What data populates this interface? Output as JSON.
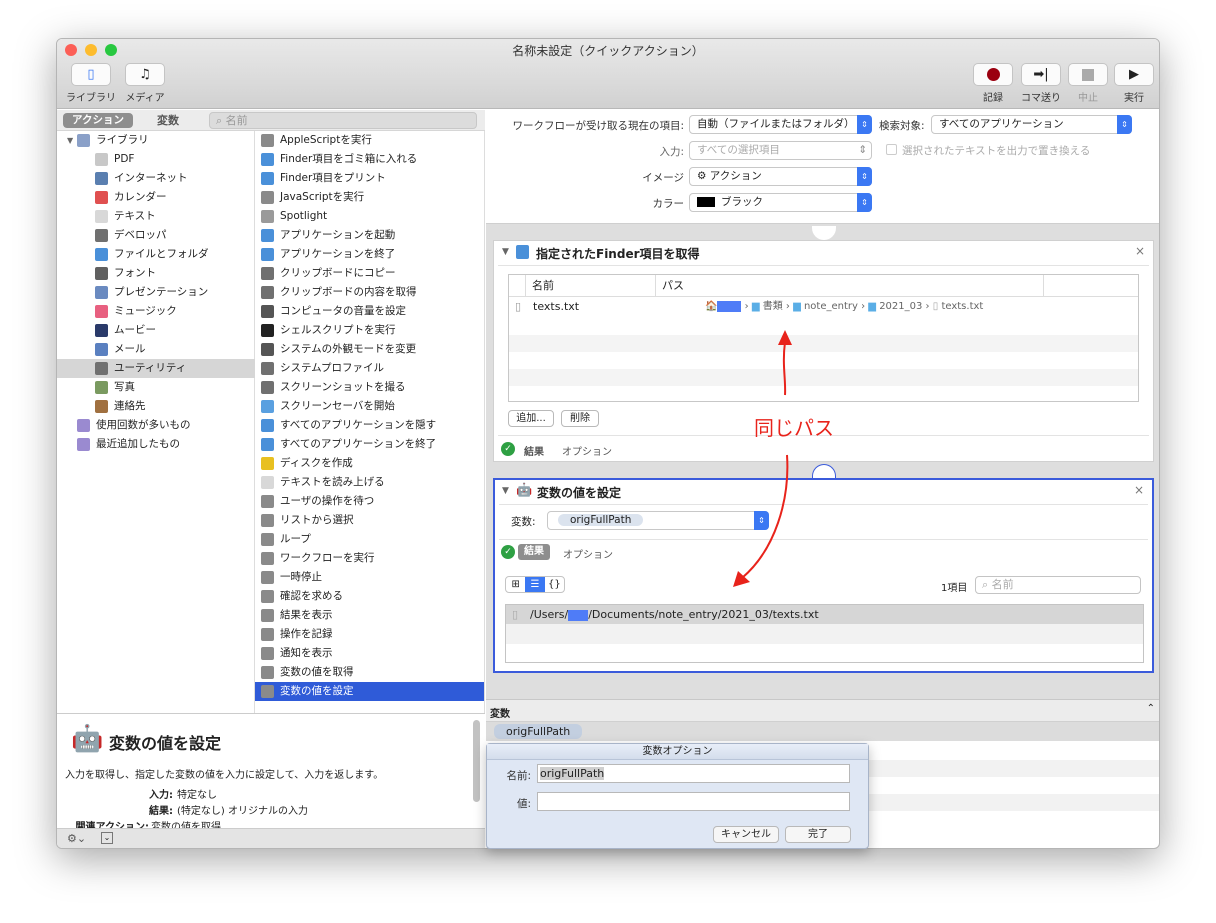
{
  "window": {
    "title": "名称未設定（クイックアクション）"
  },
  "toolbar": {
    "library": "ライブラリ",
    "media": "メディア",
    "record": "記録",
    "step": "コマ送り",
    "stop": "中止",
    "run": "実行"
  },
  "left_tabs": {
    "actions": "アクション",
    "variables": "変数",
    "search_placeholder": "名前"
  },
  "library": [
    {
      "label": "ライブラリ",
      "icon": "library-icon",
      "color": "#8aa0c8"
    },
    {
      "label": "PDF",
      "icon": "pdf-icon",
      "color": "#c8c8c8"
    },
    {
      "label": "インターネット",
      "icon": "globe-icon",
      "color": "#5a7fb0"
    },
    {
      "label": "カレンダー",
      "icon": "calendar-icon",
      "color": "#e05050"
    },
    {
      "label": "テキスト",
      "icon": "text-icon",
      "color": "#d8d8d8"
    },
    {
      "label": "デベロッパ",
      "icon": "tools-icon",
      "color": "#707070"
    },
    {
      "label": "ファイルとフォルダ",
      "icon": "finder-icon",
      "color": "#4a90d9"
    },
    {
      "label": "フォント",
      "icon": "font-icon",
      "color": "#606060"
    },
    {
      "label": "プレゼンテーション",
      "icon": "presentation-icon",
      "color": "#6a8ac0"
    },
    {
      "label": "ミュージック",
      "icon": "music-icon",
      "color": "#e86080"
    },
    {
      "label": "ムービー",
      "icon": "movie-icon",
      "color": "#2a3a6a"
    },
    {
      "label": "メール",
      "icon": "mail-icon",
      "color": "#5a80c0"
    },
    {
      "label": "ユーティリティ",
      "icon": "utility-icon",
      "color": "#707070",
      "selected": true
    },
    {
      "label": "写真",
      "icon": "photo-icon",
      "color": "#7a9a60"
    },
    {
      "label": "連絡先",
      "icon": "contacts-icon",
      "color": "#a07040"
    },
    {
      "label": "使用回数が多いもの",
      "icon": "smart-folder-icon",
      "color": "#9a8ad0"
    },
    {
      "label": "最近追加したもの",
      "icon": "smart-folder-icon",
      "color": "#9a8ad0"
    }
  ],
  "actions": [
    {
      "label": "AppleScriptを実行",
      "icon": "automator-icon"
    },
    {
      "label": "Finder項目をゴミ箱に入れる",
      "icon": "finder-icon"
    },
    {
      "label": "Finder項目をプリント",
      "icon": "finder-icon"
    },
    {
      "label": "JavaScriptを実行",
      "icon": "automator-icon"
    },
    {
      "label": "Spotlight",
      "icon": "spotlight-icon"
    },
    {
      "label": "アプリケーションを起動",
      "icon": "finder-icon"
    },
    {
      "label": "アプリケーションを終了",
      "icon": "finder-icon"
    },
    {
      "label": "クリップボードにコピー",
      "icon": "tools-icon"
    },
    {
      "label": "クリップボードの内容を取得",
      "icon": "tools-icon"
    },
    {
      "label": "コンピュータの音量を設定",
      "icon": "settings-icon"
    },
    {
      "label": "シェルスクリプトを実行",
      "icon": "terminal-icon"
    },
    {
      "label": "システムの外観モードを変更",
      "icon": "settings-icon"
    },
    {
      "label": "システムプロファイル",
      "icon": "tools-icon"
    },
    {
      "label": "スクリーンショットを撮る",
      "icon": "tools-icon"
    },
    {
      "label": "スクリーンセーバを開始",
      "icon": "screensaver-icon"
    },
    {
      "label": "すべてのアプリケーションを隠す",
      "icon": "finder-icon"
    },
    {
      "label": "すべてのアプリケーションを終了",
      "icon": "finder-icon"
    },
    {
      "label": "ディスクを作成",
      "icon": "radiation-icon"
    },
    {
      "label": "テキストを読み上げる",
      "icon": "text-icon"
    },
    {
      "label": "ユーザの操作を待つ",
      "icon": "automator-icon"
    },
    {
      "label": "リストから選択",
      "icon": "automator-icon"
    },
    {
      "label": "ループ",
      "icon": "automator-icon"
    },
    {
      "label": "ワークフローを実行",
      "icon": "automator-icon"
    },
    {
      "label": "一時停止",
      "icon": "automator-icon"
    },
    {
      "label": "確認を求める",
      "icon": "automator-icon"
    },
    {
      "label": "結果を表示",
      "icon": "automator-icon"
    },
    {
      "label": "操作を記録",
      "icon": "automator-icon"
    },
    {
      "label": "通知を表示",
      "icon": "automator-icon"
    },
    {
      "label": "変数の値を取得",
      "icon": "automator-icon"
    },
    {
      "label": "変数の値を設定",
      "icon": "automator-icon",
      "selected": true
    }
  ],
  "description": {
    "title": "変数の値を設定",
    "text": "入力を取得し、指定した変数の値を入力に設定して、入力を返します。",
    "input_label": "入力:",
    "input_value": "特定なし",
    "result_label": "結果:",
    "result_value": "(特定なし) オリジナルの入力",
    "related_label": "関連アクション:",
    "related_value": "変数の値を取得"
  },
  "workflow_settings": {
    "receives_label": "ワークフローが受け取る現在の項目:",
    "receives_value": "自動（ファイルまたはフォルダ）",
    "search_label": "検索対象:",
    "search_value": "すべてのアプリケーション",
    "input_label": "入力:",
    "input_value": "すべての選択項目",
    "replace_label": "選択されたテキストを出力で置き換える",
    "image_label": "イメージ",
    "image_value": "アクション",
    "color_label": "カラー",
    "color_value": "ブラック",
    "color_swatch": "#000000"
  },
  "action1": {
    "title": "指定されたFinder項目を取得",
    "col_name": "名前",
    "col_path": "パス",
    "row": {
      "name": "texts.txt",
      "path": [
        "書類",
        "note_entry",
        "2021_03",
        "texts.txt"
      ]
    },
    "add": "追加...",
    "remove": "削除",
    "result": "結果",
    "options": "オプション"
  },
  "annotation": {
    "text": "同じパス",
    "color": "#e8231b"
  },
  "action2": {
    "title": "変数の値を設定",
    "var_label": "変数:",
    "var_value": "origFullPath",
    "result": "結果",
    "options": "オプション",
    "count": "1項目",
    "search_placeholder": "名前",
    "path_prefix": "/Users/",
    "path_suffix": "/Documents/note_entry/2021_03/texts.txt"
  },
  "variables_panel": {
    "header": "変数",
    "token": "origFullPath"
  },
  "dialog": {
    "title": "変数オプション",
    "name_label": "名前:",
    "name_value": "origFullPath",
    "value_label": "値:",
    "value_value": "",
    "cancel": "キャンセル",
    "done": "完了"
  },
  "colors": {
    "accent": "#3b78f3",
    "selection": "#2f5bd8",
    "redact": "#4f7cf7"
  }
}
